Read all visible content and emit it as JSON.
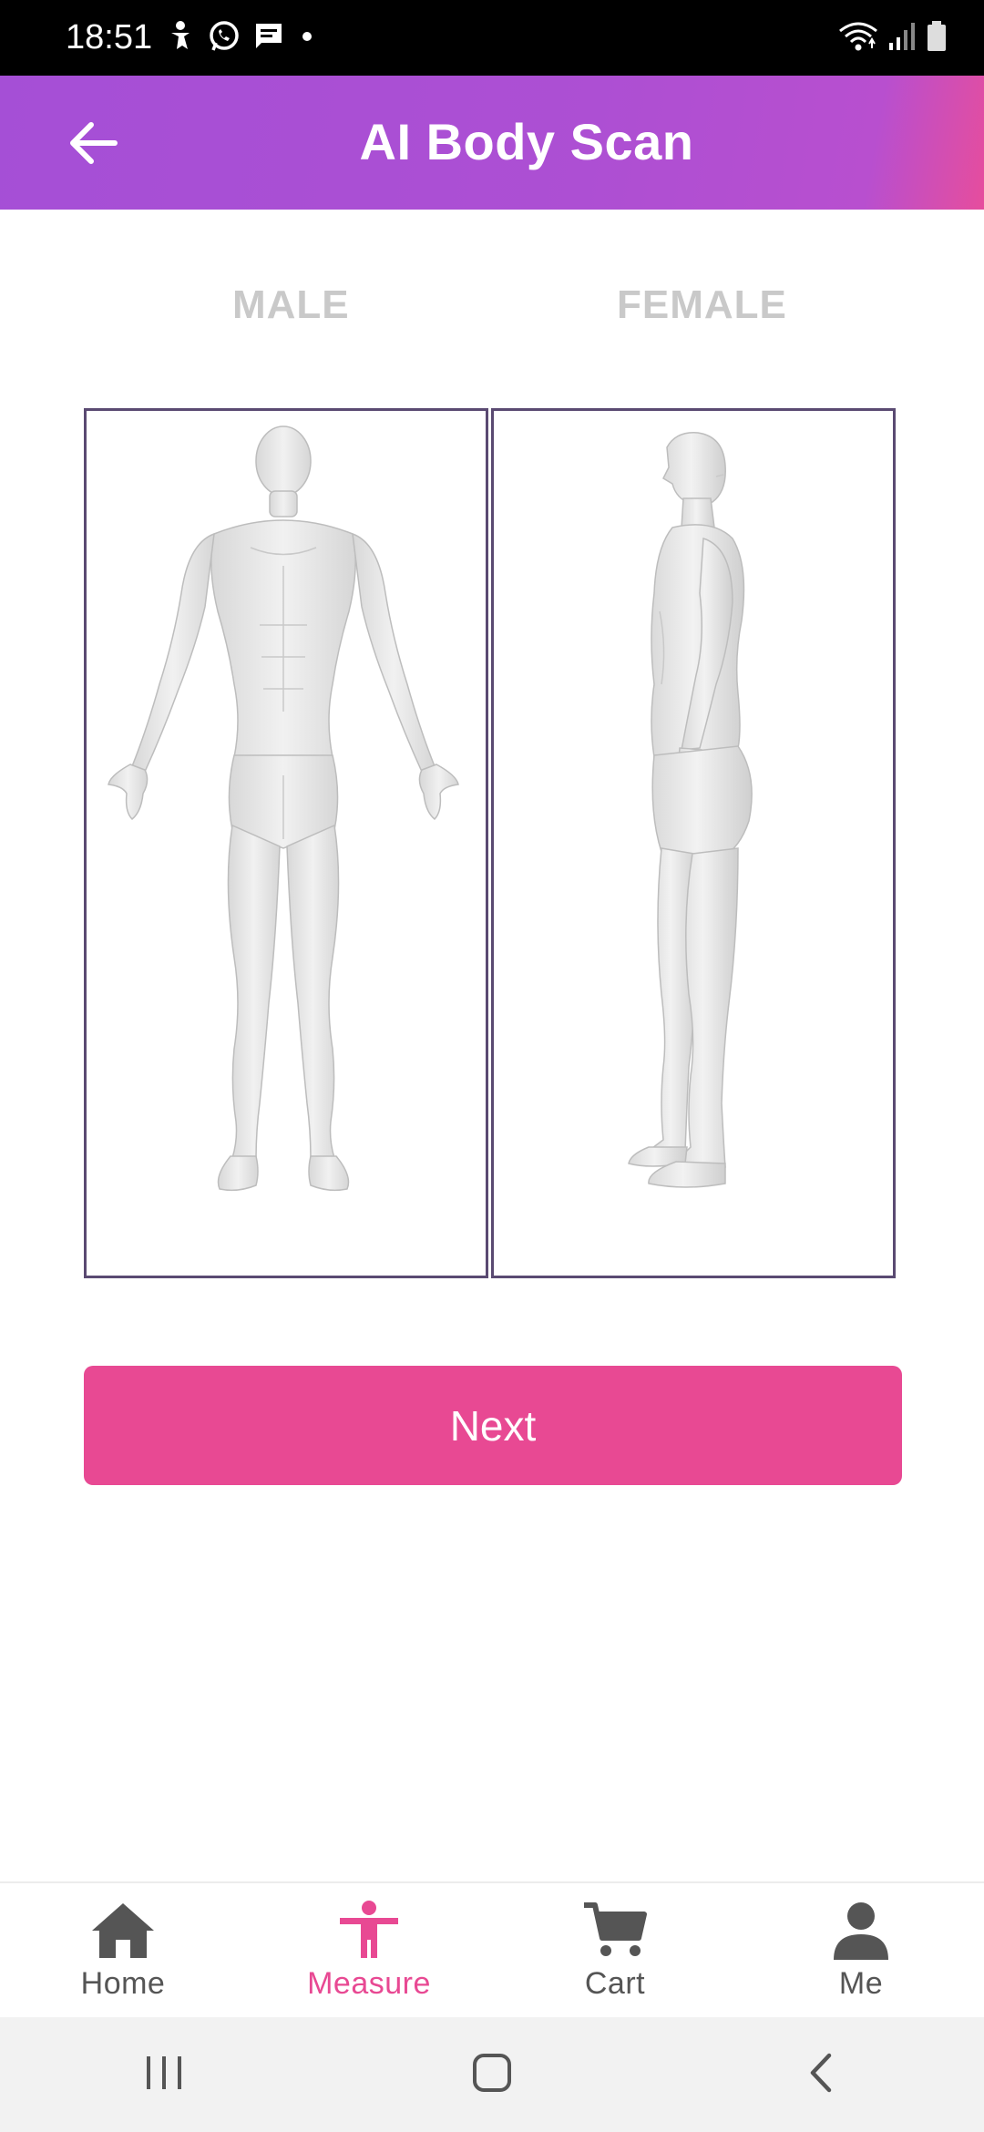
{
  "status_bar": {
    "time": "18:51",
    "left_icons": [
      "accessibility-icon",
      "whatsapp-icon",
      "message-icon",
      "dot-icon"
    ],
    "right_icons": [
      "wifi-icon",
      "signal-icon",
      "battery-icon"
    ]
  },
  "app_bar": {
    "title": "AI Body Scan",
    "back_icon": "arrow-back-icon"
  },
  "gender_tabs": [
    {
      "label": "MALE"
    },
    {
      "label": "FEMALE"
    }
  ],
  "panels": [
    {
      "view": "front",
      "icon": "body-front-icon"
    },
    {
      "view": "side",
      "icon": "body-side-icon"
    }
  ],
  "next_button": {
    "label": "Next"
  },
  "bottom_nav": {
    "active_color": "#e84993",
    "inactive_color": "#555555",
    "items": [
      {
        "label": "Home",
        "icon": "home-icon",
        "active": false
      },
      {
        "label": "Measure",
        "icon": "person-icon",
        "active": true
      },
      {
        "label": "Cart",
        "icon": "cart-icon",
        "active": false
      },
      {
        "label": "Me",
        "icon": "user-icon",
        "active": false
      }
    ]
  },
  "colors": {
    "header_gradient_start": "#a54fd6",
    "header_gradient_end": "#e64d9d",
    "accent": "#e84993",
    "panel_border": "#5a4a72"
  }
}
